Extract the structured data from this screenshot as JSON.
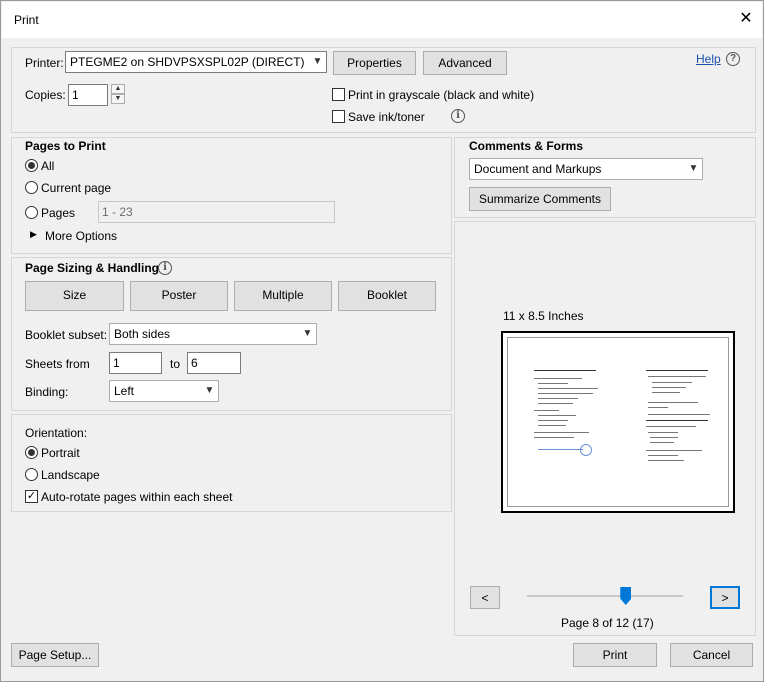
{
  "window": {
    "title": "Print"
  },
  "printer": {
    "label": "Printer:",
    "selected": "PTEGME2 on SHDVPSXSPL02P (DIRECT)",
    "properties_label": "Properties",
    "advanced_label": "Advanced",
    "help_label": "Help",
    "copies_label": "Copies:",
    "copies_value": "1",
    "grayscale_label": "Print in grayscale (black and white)",
    "grayscale_checked": false,
    "save_ink_label": "Save ink/toner",
    "save_ink_checked": false
  },
  "pages_to_print": {
    "title": "Pages to Print",
    "all_label": "All",
    "current_label": "Current page",
    "pages_label": "Pages",
    "pages_value": "1 - 23",
    "more_options_label": "More Options",
    "selected": "All"
  },
  "page_sizing": {
    "title": "Page Sizing & Handling",
    "buttons": [
      "Size",
      "Poster",
      "Multiple",
      "Booklet"
    ],
    "active": "Booklet",
    "booklet_subset_label": "Booklet subset:",
    "booklet_subset_value": "Both sides",
    "sheets_from_label": "Sheets from",
    "sheets_from_value": "1",
    "sheets_to_label": "to",
    "sheets_to_value": "6",
    "binding_label": "Binding:",
    "binding_value": "Left"
  },
  "orientation": {
    "title": "Orientation:",
    "portrait_label": "Portrait",
    "landscape_label": "Landscape",
    "auto_rotate_label": "Auto-rotate pages within each sheet",
    "selected": "Portrait",
    "auto_rotate_checked": true
  },
  "comments_forms": {
    "title": "Comments & Forms",
    "selected": "Document and Markups",
    "summarize_label": "Summarize Comments"
  },
  "preview": {
    "size_label": "11 x 8.5 Inches",
    "prev_label": "<",
    "next_label": ">",
    "page_status": "Page 8 of 12 (17)",
    "slider_position": 0.63
  },
  "footer": {
    "page_setup_label": "Page Setup...",
    "print_label": "Print",
    "cancel_label": "Cancel"
  },
  "icons": {
    "close": "close-icon",
    "help": "help-circle-icon",
    "info": "info-icon",
    "dropdown": "chevron-down-icon",
    "expand": "triangle-right-icon"
  }
}
